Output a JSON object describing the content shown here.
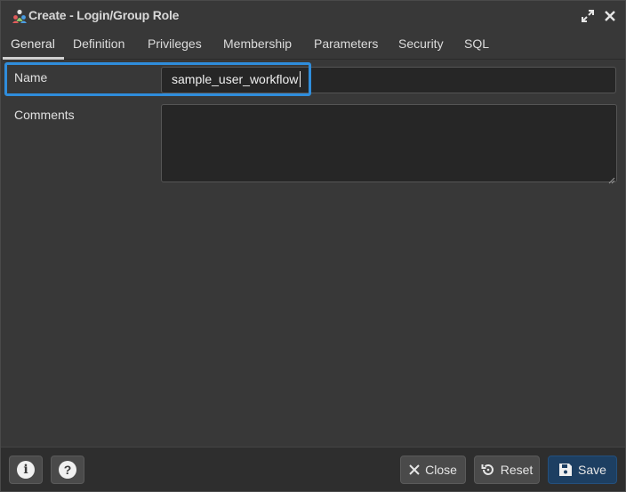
{
  "window": {
    "title": "Create - Login/Group Role",
    "expand_icon": "expand-icon",
    "close_icon": "close-icon"
  },
  "tabs": [
    {
      "label": "General",
      "active": true
    },
    {
      "label": "Definition",
      "active": false
    },
    {
      "label": "Privileges",
      "active": false
    },
    {
      "label": "Membership",
      "active": false
    },
    {
      "label": "Parameters",
      "active": false
    },
    {
      "label": "Security",
      "active": false
    },
    {
      "label": "SQL",
      "active": false
    }
  ],
  "form": {
    "name_label": "Name",
    "name_value": "sample_user_workflow",
    "comments_label": "Comments",
    "comments_value": ""
  },
  "footer": {
    "info_icon": "info-icon",
    "help_icon": "help-icon",
    "close_label": "Close",
    "reset_label": "Reset",
    "save_label": "Save"
  },
  "colors": {
    "highlight": "#2f8ddc",
    "save_button": "#1d3f62",
    "background": "#383838"
  }
}
